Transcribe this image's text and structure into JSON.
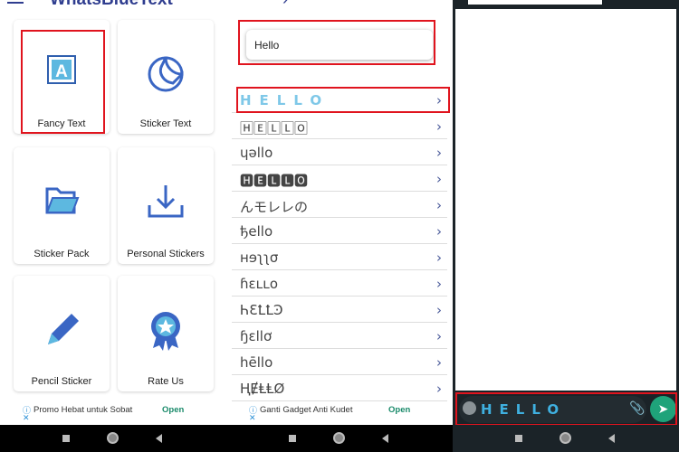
{
  "app": {
    "title": "WhatsBlueText"
  },
  "menu": {
    "cards": [
      {
        "label": "Fancy Text",
        "icon": "fancy-text-icon"
      },
      {
        "label": "Sticker Text",
        "icon": "sticker-icon"
      },
      {
        "label": "Sticker Pack",
        "icon": "folder-icon"
      },
      {
        "label": "Personal Stickers",
        "icon": "download-icon"
      },
      {
        "label": "Pencil Sticker",
        "icon": "pencil-icon"
      },
      {
        "label": "Rate Us",
        "icon": "award-icon"
      }
    ]
  },
  "ads": [
    {
      "text": "Promo Hebat untuk Sobat",
      "action": "Open"
    },
    {
      "text": "Ganti Gadget Anti Kudet",
      "action": "Open"
    }
  ],
  "fancy": {
    "input_value": "Hello",
    "styles": [
      "HELLO",
      "🄷🄴🄻🄻🄾",
      "ɥəllo",
      "🅷🅴🅻🅻🅾",
      "んモレレの",
      "ђello",
      "ʜɘʅʅσ",
      "ɦɛʟʟօ",
      "ҺƐꝈꝈϿ",
      "ɧɛllơ",
      "hēllo",
      "ⱧɆⱠⱠØ"
    ]
  },
  "chat": {
    "message_value": "HELLO"
  },
  "colors": {
    "accent": "#2f3d8f",
    "blue_text": "#7fc8e8",
    "highlight": "#e0141e",
    "send": "#1fa37a"
  }
}
